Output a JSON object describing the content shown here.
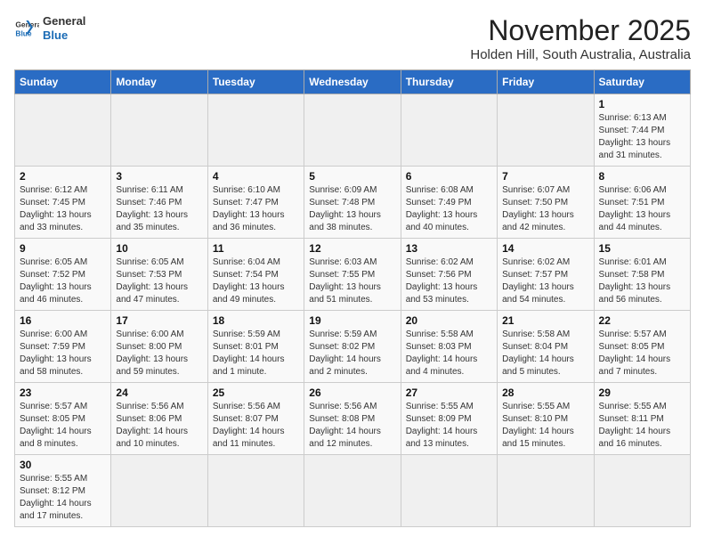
{
  "header": {
    "logo_general": "General",
    "logo_blue": "Blue",
    "main_title": "November 2025",
    "subtitle": "Holden Hill, South Australia, Australia"
  },
  "weekdays": [
    "Sunday",
    "Monday",
    "Tuesday",
    "Wednesday",
    "Thursday",
    "Friday",
    "Saturday"
  ],
  "weeks": [
    [
      {
        "day": "",
        "info": ""
      },
      {
        "day": "",
        "info": ""
      },
      {
        "day": "",
        "info": ""
      },
      {
        "day": "",
        "info": ""
      },
      {
        "day": "",
        "info": ""
      },
      {
        "day": "",
        "info": ""
      },
      {
        "day": "1",
        "info": "Sunrise: 6:13 AM\nSunset: 7:44 PM\nDaylight: 13 hours and 31 minutes."
      }
    ],
    [
      {
        "day": "2",
        "info": "Sunrise: 6:12 AM\nSunset: 7:45 PM\nDaylight: 13 hours and 33 minutes."
      },
      {
        "day": "3",
        "info": "Sunrise: 6:11 AM\nSunset: 7:46 PM\nDaylight: 13 hours and 35 minutes."
      },
      {
        "day": "4",
        "info": "Sunrise: 6:10 AM\nSunset: 7:47 PM\nDaylight: 13 hours and 36 minutes."
      },
      {
        "day": "5",
        "info": "Sunrise: 6:09 AM\nSunset: 7:48 PM\nDaylight: 13 hours and 38 minutes."
      },
      {
        "day": "6",
        "info": "Sunrise: 6:08 AM\nSunset: 7:49 PM\nDaylight: 13 hours and 40 minutes."
      },
      {
        "day": "7",
        "info": "Sunrise: 6:07 AM\nSunset: 7:50 PM\nDaylight: 13 hours and 42 minutes."
      },
      {
        "day": "8",
        "info": "Sunrise: 6:06 AM\nSunset: 7:51 PM\nDaylight: 13 hours and 44 minutes."
      }
    ],
    [
      {
        "day": "9",
        "info": "Sunrise: 6:05 AM\nSunset: 7:52 PM\nDaylight: 13 hours and 46 minutes."
      },
      {
        "day": "10",
        "info": "Sunrise: 6:05 AM\nSunset: 7:53 PM\nDaylight: 13 hours and 47 minutes."
      },
      {
        "day": "11",
        "info": "Sunrise: 6:04 AM\nSunset: 7:54 PM\nDaylight: 13 hours and 49 minutes."
      },
      {
        "day": "12",
        "info": "Sunrise: 6:03 AM\nSunset: 7:55 PM\nDaylight: 13 hours and 51 minutes."
      },
      {
        "day": "13",
        "info": "Sunrise: 6:02 AM\nSunset: 7:56 PM\nDaylight: 13 hours and 53 minutes."
      },
      {
        "day": "14",
        "info": "Sunrise: 6:02 AM\nSunset: 7:57 PM\nDaylight: 13 hours and 54 minutes."
      },
      {
        "day": "15",
        "info": "Sunrise: 6:01 AM\nSunset: 7:58 PM\nDaylight: 13 hours and 56 minutes."
      }
    ],
    [
      {
        "day": "16",
        "info": "Sunrise: 6:00 AM\nSunset: 7:59 PM\nDaylight: 13 hours and 58 minutes."
      },
      {
        "day": "17",
        "info": "Sunrise: 6:00 AM\nSunset: 8:00 PM\nDaylight: 13 hours and 59 minutes."
      },
      {
        "day": "18",
        "info": "Sunrise: 5:59 AM\nSunset: 8:01 PM\nDaylight: 14 hours and 1 minute."
      },
      {
        "day": "19",
        "info": "Sunrise: 5:59 AM\nSunset: 8:02 PM\nDaylight: 14 hours and 2 minutes."
      },
      {
        "day": "20",
        "info": "Sunrise: 5:58 AM\nSunset: 8:03 PM\nDaylight: 14 hours and 4 minutes."
      },
      {
        "day": "21",
        "info": "Sunrise: 5:58 AM\nSunset: 8:04 PM\nDaylight: 14 hours and 5 minutes."
      },
      {
        "day": "22",
        "info": "Sunrise: 5:57 AM\nSunset: 8:05 PM\nDaylight: 14 hours and 7 minutes."
      }
    ],
    [
      {
        "day": "23",
        "info": "Sunrise: 5:57 AM\nSunset: 8:05 PM\nDaylight: 14 hours and 8 minutes."
      },
      {
        "day": "24",
        "info": "Sunrise: 5:56 AM\nSunset: 8:06 PM\nDaylight: 14 hours and 10 minutes."
      },
      {
        "day": "25",
        "info": "Sunrise: 5:56 AM\nSunset: 8:07 PM\nDaylight: 14 hours and 11 minutes."
      },
      {
        "day": "26",
        "info": "Sunrise: 5:56 AM\nSunset: 8:08 PM\nDaylight: 14 hours and 12 minutes."
      },
      {
        "day": "27",
        "info": "Sunrise: 5:55 AM\nSunset: 8:09 PM\nDaylight: 14 hours and 13 minutes."
      },
      {
        "day": "28",
        "info": "Sunrise: 5:55 AM\nSunset: 8:10 PM\nDaylight: 14 hours and 15 minutes."
      },
      {
        "day": "29",
        "info": "Sunrise: 5:55 AM\nSunset: 8:11 PM\nDaylight: 14 hours and 16 minutes."
      }
    ],
    [
      {
        "day": "30",
        "info": "Sunrise: 5:55 AM\nSunset: 8:12 PM\nDaylight: 14 hours and 17 minutes."
      },
      {
        "day": "",
        "info": ""
      },
      {
        "day": "",
        "info": ""
      },
      {
        "day": "",
        "info": ""
      },
      {
        "day": "",
        "info": ""
      },
      {
        "day": "",
        "info": ""
      },
      {
        "day": "",
        "info": ""
      }
    ]
  ]
}
